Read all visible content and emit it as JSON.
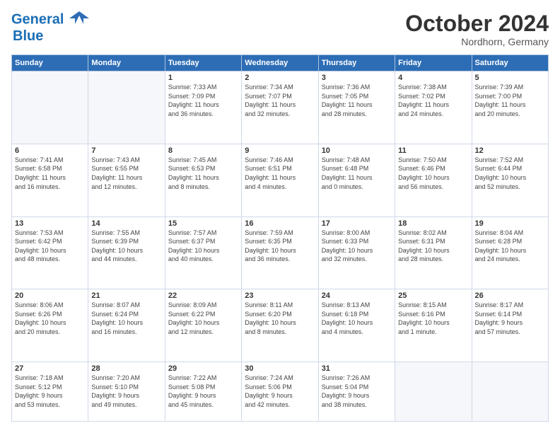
{
  "header": {
    "logo_line1": "General",
    "logo_line2": "Blue",
    "month": "October 2024",
    "location": "Nordhorn, Germany"
  },
  "weekdays": [
    "Sunday",
    "Monday",
    "Tuesday",
    "Wednesday",
    "Thursday",
    "Friday",
    "Saturday"
  ],
  "weeks": [
    [
      {
        "day": "",
        "info": ""
      },
      {
        "day": "",
        "info": ""
      },
      {
        "day": "1",
        "info": "Sunrise: 7:33 AM\nSunset: 7:09 PM\nDaylight: 11 hours\nand 36 minutes."
      },
      {
        "day": "2",
        "info": "Sunrise: 7:34 AM\nSunset: 7:07 PM\nDaylight: 11 hours\nand 32 minutes."
      },
      {
        "day": "3",
        "info": "Sunrise: 7:36 AM\nSunset: 7:05 PM\nDaylight: 11 hours\nand 28 minutes."
      },
      {
        "day": "4",
        "info": "Sunrise: 7:38 AM\nSunset: 7:02 PM\nDaylight: 11 hours\nand 24 minutes."
      },
      {
        "day": "5",
        "info": "Sunrise: 7:39 AM\nSunset: 7:00 PM\nDaylight: 11 hours\nand 20 minutes."
      }
    ],
    [
      {
        "day": "6",
        "info": "Sunrise: 7:41 AM\nSunset: 6:58 PM\nDaylight: 11 hours\nand 16 minutes."
      },
      {
        "day": "7",
        "info": "Sunrise: 7:43 AM\nSunset: 6:55 PM\nDaylight: 11 hours\nand 12 minutes."
      },
      {
        "day": "8",
        "info": "Sunrise: 7:45 AM\nSunset: 6:53 PM\nDaylight: 11 hours\nand 8 minutes."
      },
      {
        "day": "9",
        "info": "Sunrise: 7:46 AM\nSunset: 6:51 PM\nDaylight: 11 hours\nand 4 minutes."
      },
      {
        "day": "10",
        "info": "Sunrise: 7:48 AM\nSunset: 6:48 PM\nDaylight: 11 hours\nand 0 minutes."
      },
      {
        "day": "11",
        "info": "Sunrise: 7:50 AM\nSunset: 6:46 PM\nDaylight: 10 hours\nand 56 minutes."
      },
      {
        "day": "12",
        "info": "Sunrise: 7:52 AM\nSunset: 6:44 PM\nDaylight: 10 hours\nand 52 minutes."
      }
    ],
    [
      {
        "day": "13",
        "info": "Sunrise: 7:53 AM\nSunset: 6:42 PM\nDaylight: 10 hours\nand 48 minutes."
      },
      {
        "day": "14",
        "info": "Sunrise: 7:55 AM\nSunset: 6:39 PM\nDaylight: 10 hours\nand 44 minutes."
      },
      {
        "day": "15",
        "info": "Sunrise: 7:57 AM\nSunset: 6:37 PM\nDaylight: 10 hours\nand 40 minutes."
      },
      {
        "day": "16",
        "info": "Sunrise: 7:59 AM\nSunset: 6:35 PM\nDaylight: 10 hours\nand 36 minutes."
      },
      {
        "day": "17",
        "info": "Sunrise: 8:00 AM\nSunset: 6:33 PM\nDaylight: 10 hours\nand 32 minutes."
      },
      {
        "day": "18",
        "info": "Sunrise: 8:02 AM\nSunset: 6:31 PM\nDaylight: 10 hours\nand 28 minutes."
      },
      {
        "day": "19",
        "info": "Sunrise: 8:04 AM\nSunset: 6:28 PM\nDaylight: 10 hours\nand 24 minutes."
      }
    ],
    [
      {
        "day": "20",
        "info": "Sunrise: 8:06 AM\nSunset: 6:26 PM\nDaylight: 10 hours\nand 20 minutes."
      },
      {
        "day": "21",
        "info": "Sunrise: 8:07 AM\nSunset: 6:24 PM\nDaylight: 10 hours\nand 16 minutes."
      },
      {
        "day": "22",
        "info": "Sunrise: 8:09 AM\nSunset: 6:22 PM\nDaylight: 10 hours\nand 12 minutes."
      },
      {
        "day": "23",
        "info": "Sunrise: 8:11 AM\nSunset: 6:20 PM\nDaylight: 10 hours\nand 8 minutes."
      },
      {
        "day": "24",
        "info": "Sunrise: 8:13 AM\nSunset: 6:18 PM\nDaylight: 10 hours\nand 4 minutes."
      },
      {
        "day": "25",
        "info": "Sunrise: 8:15 AM\nSunset: 6:16 PM\nDaylight: 10 hours\nand 1 minute."
      },
      {
        "day": "26",
        "info": "Sunrise: 8:17 AM\nSunset: 6:14 PM\nDaylight: 9 hours\nand 57 minutes."
      }
    ],
    [
      {
        "day": "27",
        "info": "Sunrise: 7:18 AM\nSunset: 5:12 PM\nDaylight: 9 hours\nand 53 minutes."
      },
      {
        "day": "28",
        "info": "Sunrise: 7:20 AM\nSunset: 5:10 PM\nDaylight: 9 hours\nand 49 minutes."
      },
      {
        "day": "29",
        "info": "Sunrise: 7:22 AM\nSunset: 5:08 PM\nDaylight: 9 hours\nand 45 minutes."
      },
      {
        "day": "30",
        "info": "Sunrise: 7:24 AM\nSunset: 5:06 PM\nDaylight: 9 hours\nand 42 minutes."
      },
      {
        "day": "31",
        "info": "Sunrise: 7:26 AM\nSunset: 5:04 PM\nDaylight: 9 hours\nand 38 minutes."
      },
      {
        "day": "",
        "info": ""
      },
      {
        "day": "",
        "info": ""
      }
    ]
  ]
}
